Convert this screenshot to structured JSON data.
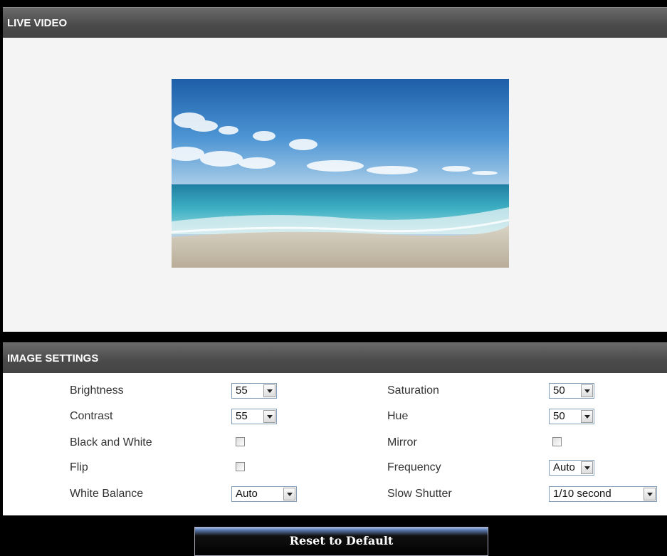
{
  "live_video": {
    "title": "LIVE VIDEO"
  },
  "image_settings": {
    "title": "IMAGE SETTINGS",
    "left": [
      {
        "label": "Brightness",
        "type": "select",
        "value": "55"
      },
      {
        "label": "Contrast",
        "type": "select",
        "value": "55"
      },
      {
        "label": "Black and White",
        "type": "checkbox",
        "checked": false
      },
      {
        "label": "Flip",
        "type": "checkbox",
        "checked": false
      },
      {
        "label": "White Balance",
        "type": "select",
        "value": "Auto"
      }
    ],
    "right": [
      {
        "label": "Saturation",
        "type": "select",
        "value": "50"
      },
      {
        "label": "Hue",
        "type": "select",
        "value": "50"
      },
      {
        "label": "Mirror",
        "type": "checkbox",
        "checked": false
      },
      {
        "label": "Frequency",
        "type": "select",
        "value": "Auto"
      },
      {
        "label": "Slow Shutter",
        "type": "select",
        "value": "1/10 second"
      }
    ]
  },
  "reset_button": {
    "label": "Reset to Default"
  },
  "icons": {
    "dropdown": "chevron-down-icon"
  }
}
